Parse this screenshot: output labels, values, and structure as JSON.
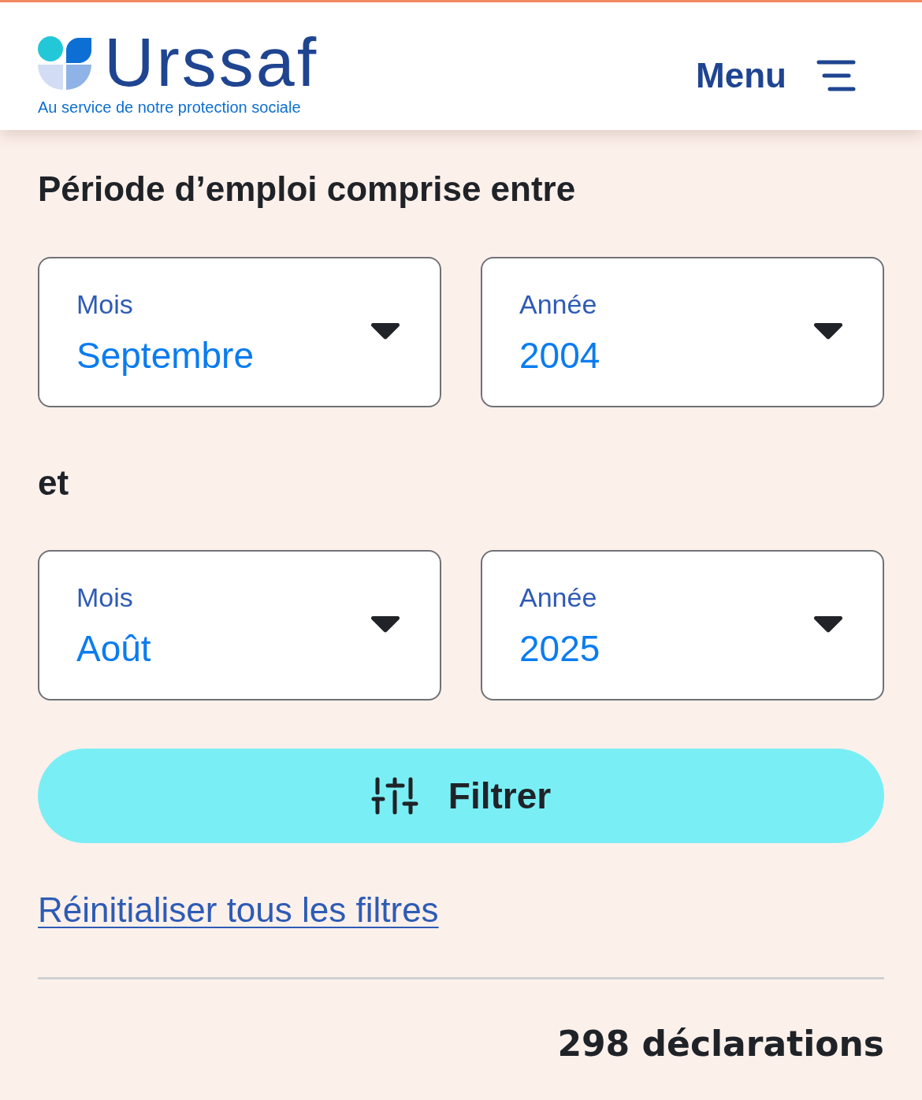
{
  "header": {
    "logo": {
      "wordmark": "Urssaf",
      "tagline": "Au service de notre protection sociale"
    },
    "menu": {
      "label": "Menu"
    }
  },
  "period": {
    "title": "Période d’emploi comprise entre",
    "from": [
      {
        "label": "Mois",
        "value": "Septembre"
      },
      {
        "label": "Année",
        "value": "2004"
      }
    ],
    "connector": "et",
    "to": [
      {
        "label": "Mois",
        "value": "Août"
      },
      {
        "label": "Année",
        "value": "2025"
      }
    ]
  },
  "filter_button": {
    "label": "Filtrer"
  },
  "reset_link": {
    "label": "Réinitialiser tous les filtres"
  },
  "results": {
    "count": "298 déclarations"
  }
}
